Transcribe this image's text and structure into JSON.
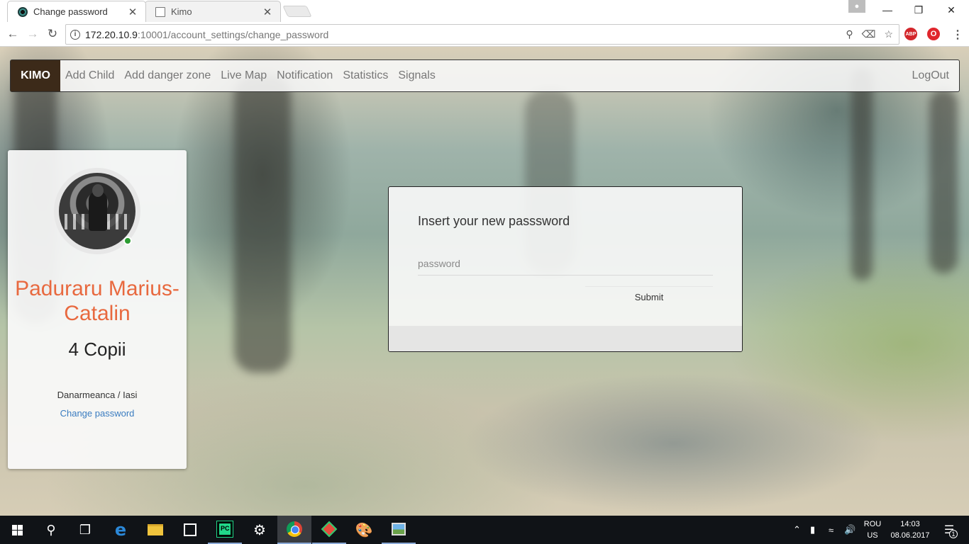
{
  "browser": {
    "tabs": [
      {
        "title": "Change password",
        "close": "✕"
      },
      {
        "title": "Kimo",
        "close": "✕"
      }
    ],
    "url_host": "172.20.10.9",
    "url_path": ":10001/account_settings/change_password",
    "window_controls": {
      "minimize": "—",
      "maximize": "❐",
      "close": "✕"
    },
    "extensions": {
      "adblock": "ABP",
      "opera": "O"
    }
  },
  "navbar": {
    "brand": "KIMO",
    "links": [
      "Add Child",
      "Add danger zone",
      "Live Map",
      "Notification",
      "Statistics",
      "Signals"
    ],
    "logout": "LogOut"
  },
  "profile": {
    "name": "Paduraru Marius-Catalin",
    "kids": "4 Copii",
    "location": "Danarmeanca / Iasi",
    "change_password_link": "Change password",
    "status_color": "#2c9c32"
  },
  "form": {
    "title": "Insert your new passsword",
    "password_placeholder": "password",
    "password_value": "",
    "submit_label": "Submit"
  },
  "taskbar": {
    "language": {
      "line1": "ROU",
      "line2": "US"
    },
    "time": "14:03",
    "date": "08.06.2017",
    "notification_count": "1"
  },
  "colors": {
    "brand_bg": "#3c2a19",
    "name_accent": "#e8693f",
    "link": "#3a7cc0"
  }
}
